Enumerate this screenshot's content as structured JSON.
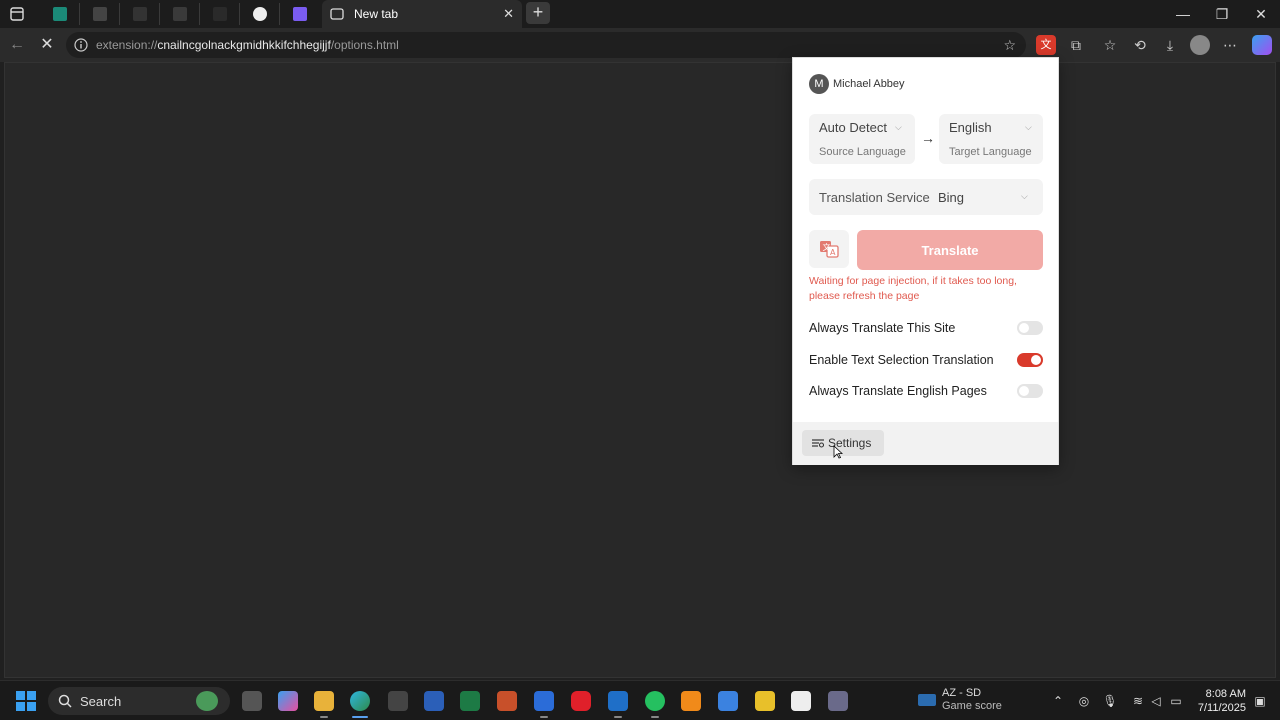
{
  "browser": {
    "active_tab_title": "New tab",
    "url_scheme": "extension://",
    "url_host": "cnailncgolnackgmidhkkifchhegijjf",
    "url_path": "/options.html"
  },
  "popup": {
    "user": {
      "initial": "M",
      "name": "Michael Abbey"
    },
    "source": {
      "value": "Auto Detect",
      "label": "Source Language"
    },
    "target": {
      "value": "English",
      "label": "Target Language"
    },
    "service": {
      "label": "Translation Service",
      "value": "Bing"
    },
    "translate_label": "Translate",
    "status_message": "Waiting for page injection, if it takes too long, please refresh the page",
    "options": [
      {
        "label": "Always Translate This Site",
        "enabled": false
      },
      {
        "label": "Enable Text Selection Translation",
        "enabled": true
      },
      {
        "label": "Always Translate English Pages",
        "enabled": false
      }
    ],
    "settings_label": "Settings"
  },
  "taskbar": {
    "search_label": "Search",
    "weather_title": "AZ - SD",
    "weather_sub": "Game score",
    "time": "8:08 AM",
    "date": "7/11/2025"
  },
  "colors": {
    "accent": "#d93a2b",
    "translate_disabled": "#f2aaa6",
    "status_text": "#e05a4f"
  }
}
